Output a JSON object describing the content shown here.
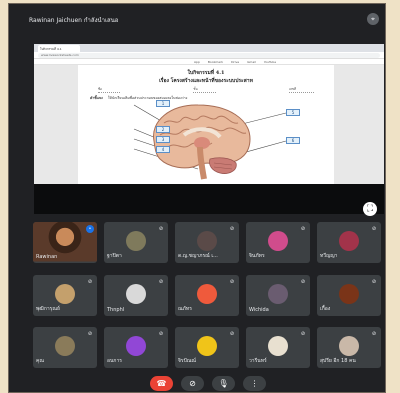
{
  "presentation": {
    "presenter_label": "Rawinan Jaichuen กำลังนำเสนอ",
    "pin_icon": "pin-icon"
  },
  "browser": {
    "tab_title": "ใบกิจกรรมที่ 4.1",
    "address": "www.liveworksheets.com",
    "bookmarks": [
      "App",
      "Bookmark",
      "Drive",
      "Gmail",
      "YouTube"
    ]
  },
  "worksheet": {
    "title": "ใบกิจกรรมที่ 4.1",
    "subtitle": "เรื่อง โครงสร้างและหน้าที่ของระบบประสาท",
    "fields": [
      "ชื่อ",
      "ชั้น",
      "เลขที่"
    ],
    "instruction_label": "คำชี้แจง",
    "instruction_text": "ให้นักเรียนเติมชื่อส่วนประกอบของสมองลงในช่องว่าง",
    "label_numbers": [
      "1",
      "2",
      "3",
      "4",
      "5",
      "6"
    ]
  },
  "participants": [
    {
      "name": "Rawinan",
      "avatar_text": "",
      "color": "#7a4f3a",
      "mic_active": true
    },
    {
      "name": "ฐาปิตา",
      "avatar_text": "",
      "color": "#7f7a5c",
      "mic_active": false
    },
    {
      "name": "ด.ญ.ชญาภรณ์ เ...",
      "avatar_text": "",
      "color": "#5a4a48",
      "mic_active": false
    },
    {
      "name": "จินภัทร",
      "avatar_text": "",
      "color": "#d04c8c",
      "mic_active": false
    },
    {
      "name": "ทวีญญา",
      "avatar_text": "",
      "color": "#a2334a",
      "mic_active": false
    },
    {
      "name": "พุฒิการุณย์",
      "avatar_text": "",
      "color": "#c4a06c",
      "mic_active": false
    },
    {
      "name": "Thnphl",
      "avatar_text": "",
      "color": "#d9d9d9",
      "mic_active": false
    },
    {
      "name": "ณภัทร",
      "avatar_text": "",
      "color": "#ef5a3c",
      "mic_active": false
    },
    {
      "name": "Wichida",
      "avatar_text": "",
      "color": "#6a5c70",
      "mic_active": false
    },
    {
      "name": "เกื้อง",
      "avatar_text": "",
      "color": "#7a3418",
      "mic_active": false
    },
    {
      "name": "คุณ",
      "avatar_text": "",
      "color": "#8a7b5a",
      "mic_active": false
    },
    {
      "name": "อนการ",
      "avatar_text": "",
      "color": "#9147d6",
      "mic_active": false
    },
    {
      "name": "จิรปัณณ์",
      "avatar_text": "",
      "color": "#f0c419",
      "mic_active": false
    },
    {
      "name": "วารีนทร์",
      "avatar_text": "",
      "color": "#e8e0d0",
      "mic_active": false
    },
    {
      "name": "สุปรีย  อีก 18 คน",
      "avatar_text": "",
      "color": "#c9b8a8",
      "mic_active": false
    }
  ],
  "controls": {
    "end_call_icon": "phone-hangup-icon",
    "camera_icon": "camera-off-icon",
    "mic_icon": "mic-off-icon",
    "more_icon": "more-vert-icon",
    "more_label": "⋮"
  },
  "colors": {
    "meet_bg": "#202124",
    "tile_bg": "#3c4043",
    "end_call": "#ea4335",
    "highlight": "#1a73e8"
  }
}
